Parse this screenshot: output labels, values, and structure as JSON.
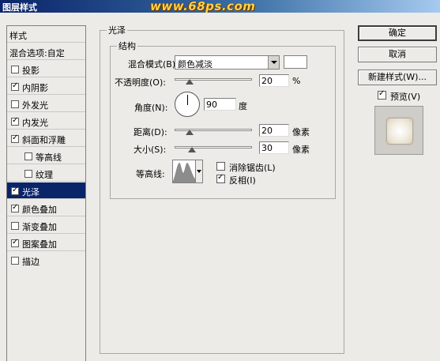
{
  "window": {
    "title": "图层样式",
    "watermark": "www.68ps.com"
  },
  "stylelist": {
    "header": "样式",
    "blend_options": "混合选项:自定",
    "items": [
      {
        "label": "投影",
        "checked": false
      },
      {
        "label": "内阴影",
        "checked": true
      },
      {
        "label": "外发光",
        "checked": false
      },
      {
        "label": "内发光",
        "checked": true
      },
      {
        "label": "斜面和浮雕",
        "checked": true
      },
      {
        "label": "等高线",
        "checked": false
      },
      {
        "label": "纹理",
        "checked": false
      },
      {
        "label": "光泽",
        "checked": true,
        "selected": true
      },
      {
        "label": "颜色叠加",
        "checked": true
      },
      {
        "label": "渐变叠加",
        "checked": false
      },
      {
        "label": "图案叠加",
        "checked": true
      },
      {
        "label": "描边",
        "checked": false
      }
    ]
  },
  "satin": {
    "group_title": "光泽",
    "structure_title": "结构",
    "blend_mode_label": "混合模式(B):",
    "blend_mode_value": "颜色减淡",
    "blend_color": "#ffffff",
    "opacity_label": "不透明度(O):",
    "opacity_value": "20",
    "opacity_unit": "%",
    "angle_label": "角度(N):",
    "angle_value": "90",
    "angle_unit": "度",
    "distance_label": "距离(D):",
    "distance_value": "20",
    "distance_unit": "像素",
    "size_label": "大小(S):",
    "size_value": "30",
    "size_unit": "像素",
    "contour_label": "等高线:",
    "antialias_label": "消除锯齿(L)",
    "antialias_checked": false,
    "invert_label": "反相(I)",
    "invert_checked": true
  },
  "buttons": {
    "ok": "确定",
    "cancel": "取消",
    "new_style": "新建样式(W)...",
    "preview_label": "预览(V)",
    "preview_checked": true
  }
}
